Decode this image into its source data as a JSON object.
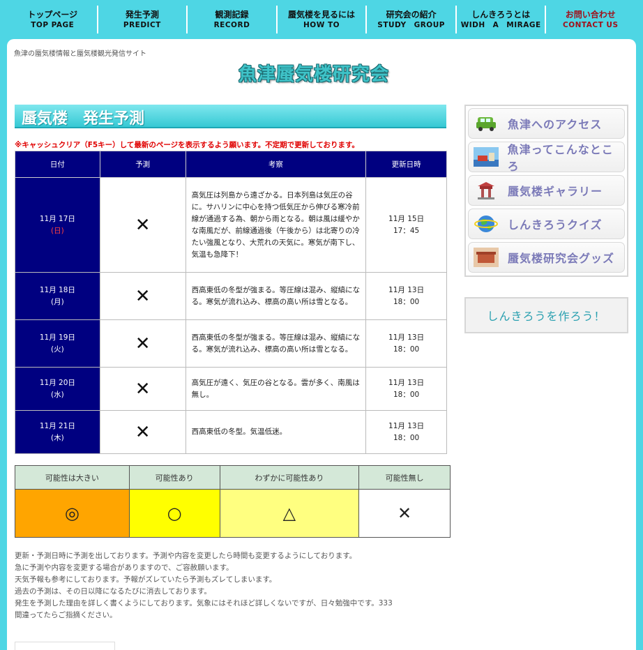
{
  "nav": [
    {
      "jp": "トップページ",
      "en": "TOP PAGE"
    },
    {
      "jp": "発生予測",
      "en": "PREDICT"
    },
    {
      "jp": "観測記録",
      "en": "RECORD"
    },
    {
      "jp": "蜃気楼を見るには",
      "en": "HOW TO"
    },
    {
      "jp": "研究会の紹介",
      "en": "STUDY　GROUP"
    },
    {
      "jp": "しんきろうとは",
      "en": "WIDH　A　MIRAGE"
    },
    {
      "jp": "お問い合わせ",
      "en": "CONTACT US"
    }
  ],
  "header": {
    "tagline": "魚津の蜃気楼情報と蜃気楼観光発信サイト",
    "logo": "魚津蜃気楼研究会"
  },
  "main": {
    "title": "蜃気楼　発生予測",
    "notice": "※キャッシュクリア（F5キー）して最新のページを表示するよう願います。不定期で更新しております。"
  },
  "forecast": {
    "headers": [
      "日付",
      "予測",
      "考察",
      "更新日時"
    ],
    "rows": [
      {
        "date": "11月 17日",
        "dow": "(日)",
        "pred": "✕",
        "obs": "高気圧は列島から遠ざかる。日本列島は気圧の谷に。サハリンに中心を持つ低気圧から伸びる寒冷前線が通過する為、朝から雨となる。朝は風は緩やかな南風だが、前線通過後（午後から）は北寄りの冷たい強風となり、大荒れの天気に。寒気が南下し、気温も急降下！",
        "upd_date": "11月 15日",
        "upd_time": "17：45"
      },
      {
        "date": "11月 18日",
        "dow": "(月)",
        "pred": "✕",
        "obs": "西高東低の冬型が強まる。等圧線は混み、縦縞になる。寒気が流れ込み、標高の高い所は雪となる。",
        "upd_date": "11月 13日",
        "upd_time": "18：00"
      },
      {
        "date": "11月 19日",
        "dow": "(火)",
        "pred": "✕",
        "obs": "西高東低の冬型が強まる。等圧線は混み、縦縞になる。寒気が流れ込み、標高の高い所は雪となる。",
        "upd_date": "11月 13日",
        "upd_time": "18：00"
      },
      {
        "date": "11月 20日",
        "dow": "(水)",
        "pred": "✕",
        "obs": "高気圧が遠く、気圧の谷となる。雲が多く、南風は無し。",
        "upd_date": "11月 13日",
        "upd_time": "18：00"
      },
      {
        "date": "11月 21日",
        "dow": "(木)",
        "pred": "✕",
        "obs": "西高東低の冬型。気温低迷。",
        "upd_date": "11月 13日",
        "upd_time": "18：00"
      }
    ]
  },
  "legend": {
    "labels": [
      "可能性は大きい",
      "可能性あり",
      "わずかに可能性あり",
      "可能性無し"
    ],
    "symbols": [
      "◎",
      "○",
      "△",
      "✕"
    ],
    "colors": [
      "#ffa500",
      "#ffff00",
      "#ffff80",
      "#ffffff"
    ]
  },
  "notes": [
    "更新・予測日時に予測を出しております。予測や内容を変更したら時間も変更するようにしております。",
    "急に予測や内容を変更する場合がありますので、ご容赦願います。",
    "天気予報も参考にしております。予報がズレていたら予測もズレてしまいます。",
    "過去の予測は、その日以降になるたびに消去しております。",
    "発生を予測した理由を詳しく書くようにしております。気象にはそれほど詳しくないですが、日々勉強中です。333",
    "間違ってたらご指摘ください。"
  ],
  "sidebar": {
    "items": [
      {
        "label": "魚津へのアクセス",
        "icon": "car-icon"
      },
      {
        "label": "魚津ってこんなところ",
        "icon": "town-icon"
      },
      {
        "label": "蜃気楼ギャラリー",
        "icon": "gallery-icon"
      },
      {
        "label": "しんきろうクイズ",
        "icon": "globe-icon"
      },
      {
        "label": "蜃気楼研究会グッズ",
        "icon": "goods-icon"
      }
    ],
    "make": "しんきろうを作ろう！"
  }
}
